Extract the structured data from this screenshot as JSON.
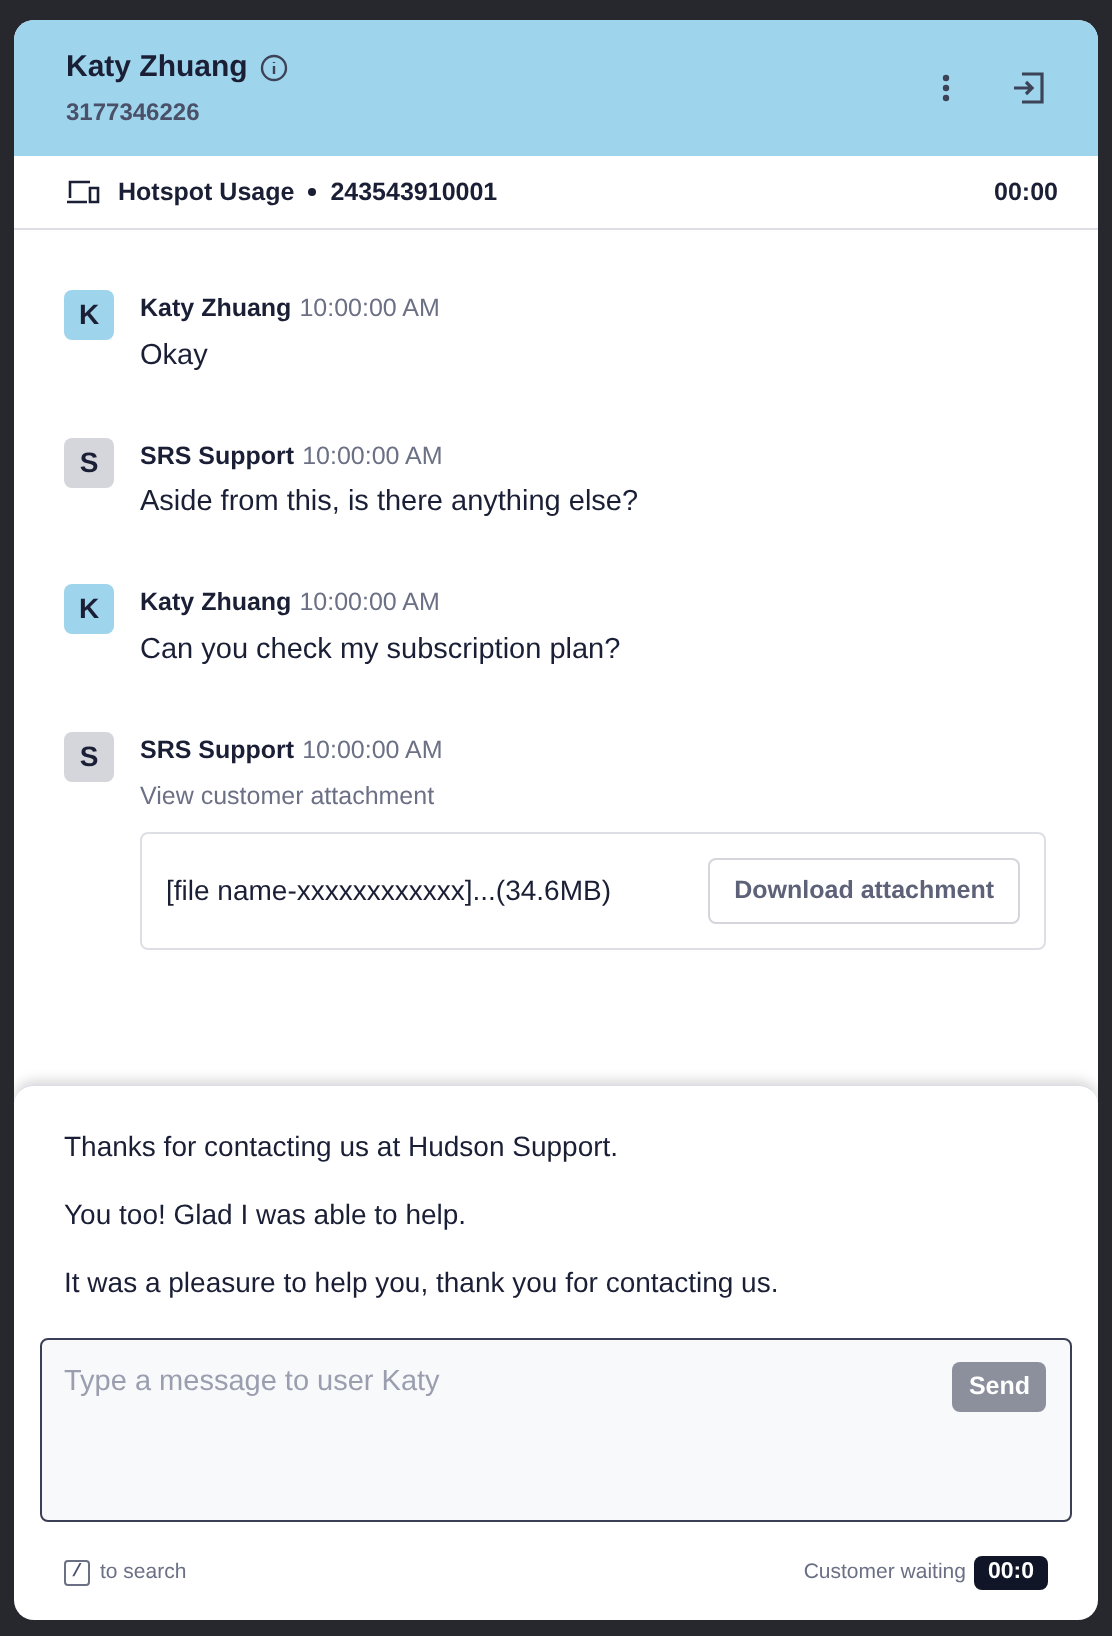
{
  "header": {
    "name": "Katy Zhuang",
    "phone": "3177346226"
  },
  "session": {
    "topic": "Hotspot Usage",
    "account": "243543910001",
    "timer": "00:00"
  },
  "messages": [
    {
      "initial": "K",
      "color": "#9fd5ec",
      "sender": "Katy Zhuang",
      "time": "10:00:00 AM",
      "text": "Okay"
    },
    {
      "initial": "S",
      "color": "#d4d6db",
      "sender": "SRS Support",
      "time": "10:00:00 AM",
      "text": "Aside from this, is there anything else?"
    },
    {
      "initial": "K",
      "color": "#9fd5ec",
      "sender": "Katy Zhuang",
      "time": "10:00:00 AM",
      "text": "Can you check my subscription plan?"
    },
    {
      "initial": "S",
      "color": "#d4d6db",
      "sender": "SRS Support",
      "time": "10:00:00 AM",
      "note": "View customer attachment",
      "attachment": {
        "file": "[file name-xxxxxxxxxxxx]...(34.6MB)",
        "button": "Download attachment"
      }
    }
  ],
  "suggestions": [
    "Thanks for contacting us at Hudson Support.",
    "You too! Glad I was able to help.",
    "It was a pleasure to help you, thank you for contacting us."
  ],
  "composer": {
    "placeholder": "Type a message to user Katy",
    "send": "Send"
  },
  "footer": {
    "key": "/",
    "hint": "to search",
    "waiting_label": "Customer waiting",
    "waiting_time": "00:0"
  }
}
